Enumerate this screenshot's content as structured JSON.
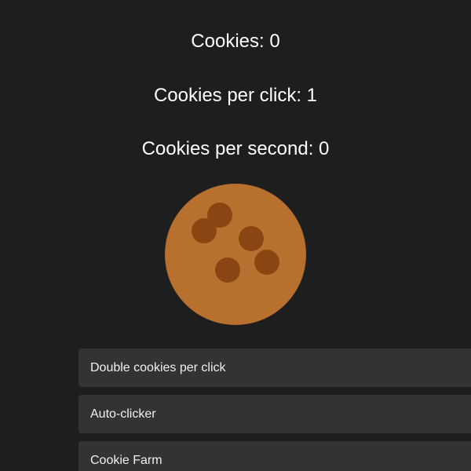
{
  "stats": {
    "cookies_text": "Cookies: 0",
    "per_click_text": "Cookies per click: 1",
    "per_second_text": "Cookies per second: 0"
  },
  "cookie": {
    "icon": "cookie-icon",
    "dough_color": "#b8702f",
    "chip_color": "#8b4513"
  },
  "upgrades": [
    {
      "label": "Double cookies per click"
    },
    {
      "label": "Auto-clicker"
    },
    {
      "label": "Cookie Farm"
    }
  ],
  "colors": {
    "background": "#1e1e1e",
    "panel": "#333333",
    "text": "#ffffff"
  }
}
